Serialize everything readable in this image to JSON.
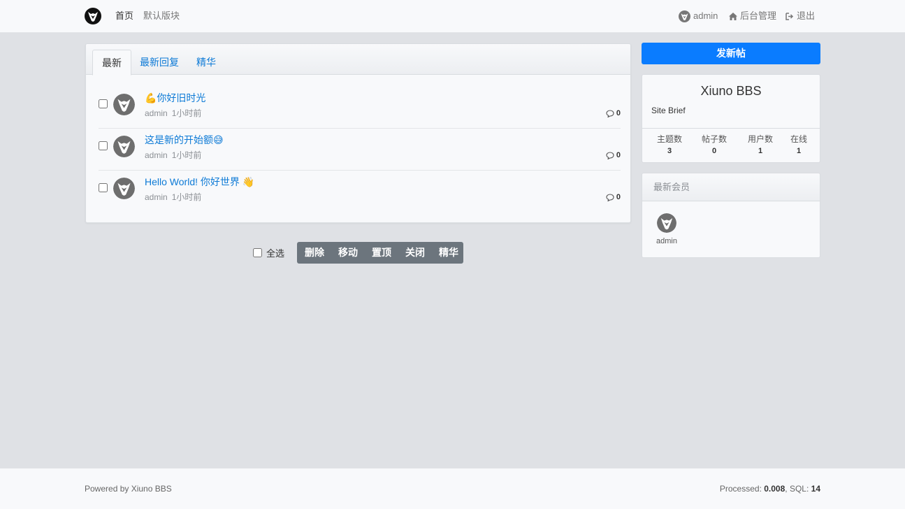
{
  "header": {
    "nav": {
      "home": "首页",
      "forum": "默认版块"
    },
    "user": "admin",
    "admin_panel": "后台管理",
    "logout": "退出"
  },
  "tabs": [
    "最新",
    "最新回复",
    "精华"
  ],
  "threads": [
    {
      "emoji_prefix": "💪",
      "title": "你好旧时光",
      "emoji_suffix": "",
      "author": "admin",
      "time": "1小时前",
      "replies": "0"
    },
    {
      "emoji_prefix": "",
      "title": "这是新的开始额",
      "emoji_suffix": "😅",
      "author": "admin",
      "time": "1小时前",
      "replies": "0"
    },
    {
      "emoji_prefix": "",
      "title": "Hello World! 你好世界 ",
      "emoji_suffix": "👋",
      "author": "admin",
      "time": "1小时前",
      "replies": "0"
    }
  ],
  "moderation": {
    "select_all": "全选",
    "buttons": [
      "删除",
      "移动",
      "置顶",
      "关闭",
      "精华"
    ]
  },
  "sidebar": {
    "new_post": "发新帖",
    "site_name": "Xiuno BBS",
    "site_brief": "Site Brief",
    "stats": [
      {
        "label": "主题数",
        "value": "3"
      },
      {
        "label": "帖子数",
        "value": "0"
      },
      {
        "label": "用户数",
        "value": "1"
      },
      {
        "label": "在线",
        "value": "1"
      }
    ],
    "members_title": "最新会员",
    "members": [
      "admin"
    ]
  },
  "footer": {
    "powered": "Powered by Xiuno BBS",
    "processed_label": "Processed: ",
    "processed_value": "0.008",
    "sql_label": ", SQL: ",
    "sql_value": "14"
  },
  "colors": {
    "accent": "#0a7cff",
    "link": "#0d7ad6",
    "mod_bar": "#6c757d"
  },
  "icons": {
    "logo": "xiuno-logo-icon",
    "admin_panel": "home-icon",
    "logout": "sign-out-icon",
    "replies": "comment-icon"
  }
}
